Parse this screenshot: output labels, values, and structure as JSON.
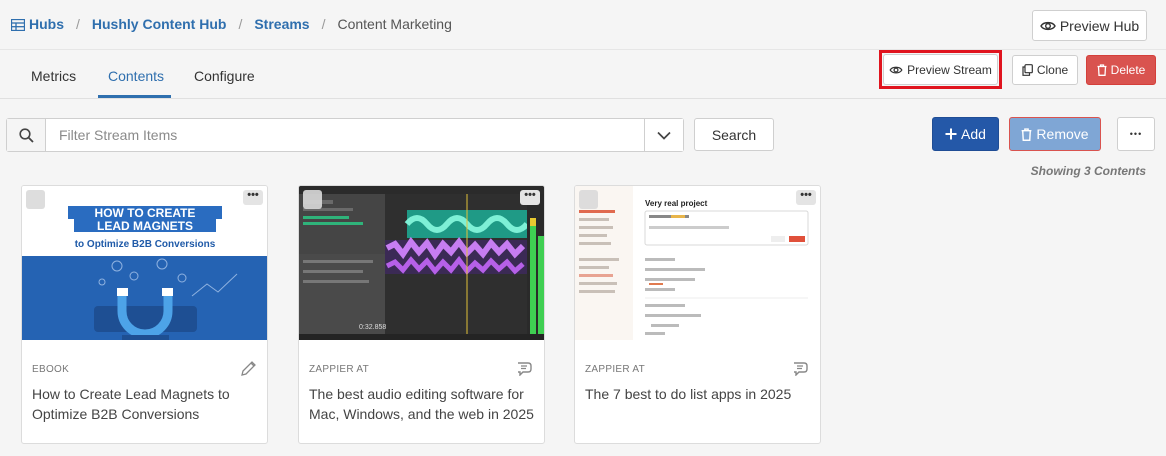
{
  "breadcrumb": {
    "items": [
      "Hubs",
      "Hushly Content Hub",
      "Streams"
    ],
    "current": "Content Marketing",
    "separator": "/"
  },
  "header": {
    "preview_hub_label": "Preview Hub"
  },
  "tabs": [
    {
      "label": "Metrics",
      "active": false
    },
    {
      "label": "Contents",
      "active": true
    },
    {
      "label": "Configure",
      "active": false
    }
  ],
  "actions": {
    "preview_stream_label": "Preview Stream",
    "clone_label": "Clone",
    "delete_label": "Delete"
  },
  "filter": {
    "placeholder": "Filter Stream Items",
    "value": "",
    "search_label": "Search",
    "add_label": "Add",
    "remove_label": "Remove",
    "more_label": "•••"
  },
  "showing_text": "Showing 3 Contents",
  "cards": [
    {
      "type": "EBOOK",
      "title": "How to Create Lead Magnets to Optimize B2B Conversions",
      "thumb_line1": "HOW TO CREATE",
      "thumb_line2": "LEAD MAGNETS",
      "thumb_line3": "to Optimize B2B Conversions"
    },
    {
      "type": "ZAPPIER AT",
      "title": "The best audio editing software for Mac, Windows, and the web in 2025",
      "thumb_time": "0:32.858"
    },
    {
      "type": "ZAPPIER AT",
      "title": "The 7 best to do list apps in 2025",
      "thumb_heading": "Very real project"
    }
  ],
  "colors": {
    "link": "#2f6fae",
    "primary": "#2458a8",
    "danger": "#d9534f",
    "highlight": "#e0141e"
  }
}
